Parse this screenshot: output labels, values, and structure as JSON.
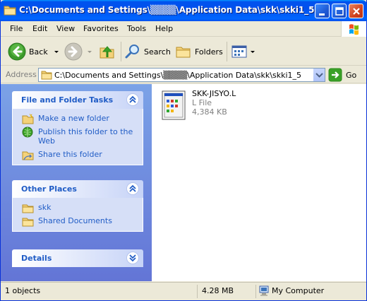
{
  "window": {
    "title": "C:\\Documents and Settings\\▒▒▒▒\\Application Data\\skk\\skki1_5"
  },
  "menu": {
    "items": [
      "File",
      "Edit",
      "View",
      "Favorites",
      "Tools",
      "Help"
    ],
    "underline": [
      "F",
      "E",
      "V",
      "a",
      "T",
      "H"
    ]
  },
  "toolbar": {
    "back_label": "Back",
    "search_label": "Search",
    "folders_label": "Folders"
  },
  "address": {
    "label": "Address",
    "value": "C:\\Documents and Settings\\▒▒▒▒\\Application Data\\skk\\skki1_5",
    "go_label": "Go"
  },
  "tasks_panel": {
    "title": "File and Folder Tasks",
    "items": [
      {
        "label": "Make a new folder",
        "icon": "new-folder-icon"
      },
      {
        "label": "Publish this folder to the Web",
        "icon": "publish-web-icon"
      },
      {
        "label": "Share this folder",
        "icon": "share-folder-icon"
      }
    ]
  },
  "places_panel": {
    "title": "Other Places",
    "items": [
      {
        "label": "skk",
        "icon": "folder-icon"
      },
      {
        "label": "Shared Documents",
        "icon": "folder-icon"
      }
    ]
  },
  "details_panel": {
    "title": "Details"
  },
  "files": [
    {
      "name": "SKK-JISYO.L",
      "type": "L File",
      "size": "4,384 KB",
      "icon": "file-icon"
    }
  ],
  "status": {
    "objects": "1 objects",
    "size": "4.28 MB",
    "zone": "My Computer"
  },
  "colors": {
    "title_bar": "#0054e3",
    "task_pane": "#6d86dc",
    "link": "#215dc6"
  }
}
